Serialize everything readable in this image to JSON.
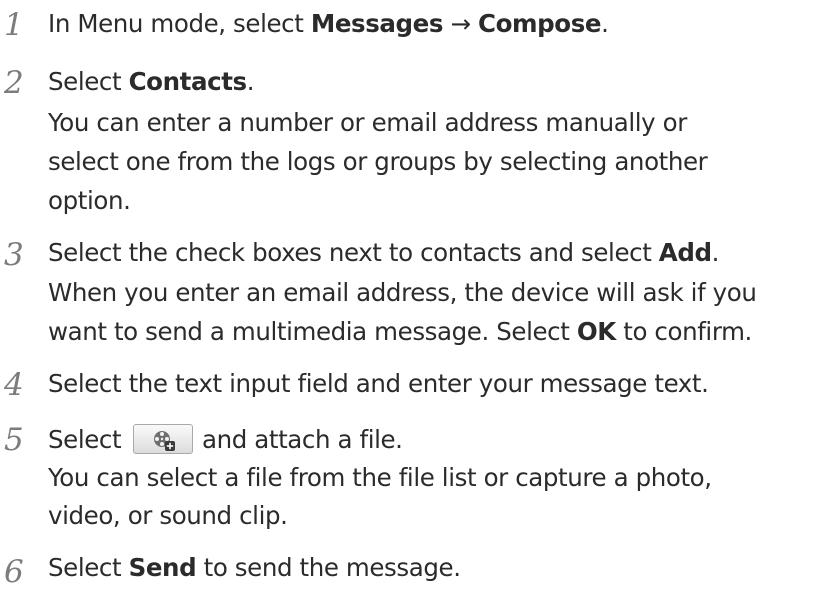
{
  "steps": [
    {
      "number": "1",
      "lines": [
        {
          "t1": "In Menu mode, select ",
          "b1": "Messages",
          "t2": " → ",
          "b2": "Compose",
          "t3": "."
        }
      ]
    },
    {
      "number": "2",
      "lines": [
        {
          "t1": "Select ",
          "b1": "Contacts",
          "t2": "."
        },
        {
          "t1": "You can enter a number or email address manually or"
        },
        {
          "t1": "select one from the logs or groups by selecting another"
        },
        {
          "t1": "option."
        }
      ]
    },
    {
      "number": "3",
      "lines": [
        {
          "t1": "Select the check boxes next to contacts and select ",
          "b1": "Add",
          "t2": "."
        },
        {
          "t1": "When you enter an email address, the device will ask if you"
        },
        {
          "t1": "want to send a multimedia message. Select ",
          "b1": "OK",
          "t2": " to confirm."
        }
      ]
    },
    {
      "number": "4",
      "lines": [
        {
          "t1": "Select the text input field and enter your message text."
        }
      ]
    },
    {
      "number": "5",
      "lines": [
        {
          "t1": "Select ",
          "t2": " and attach a file."
        },
        {
          "t1": "You can select a file from the file list or capture a photo,"
        },
        {
          "t1": "video, or sound clip."
        }
      ]
    },
    {
      "number": "6",
      "lines": [
        {
          "t1": "Select ",
          "b1": "Send",
          "t2": " to send the message."
        }
      ]
    }
  ],
  "attach_button_icon": "film-reel-add-icon"
}
